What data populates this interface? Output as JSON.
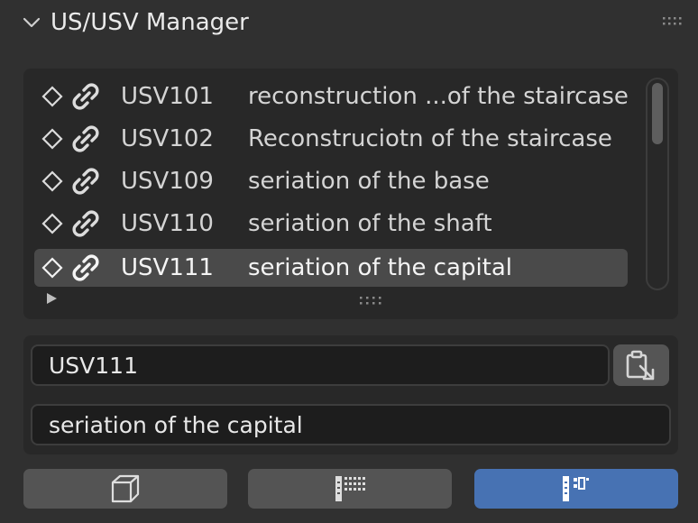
{
  "panel": {
    "title": "US/USV Manager",
    "collapse_icon": "chevron-down-icon",
    "grip_icon": "drag-grip-icon"
  },
  "list": {
    "selected_index": 4,
    "items": [
      {
        "code": "USV101",
        "description": "reconstruction ...of the staircase",
        "icon": "diamond-icon",
        "link_icon": "link-icon"
      },
      {
        "code": "USV102",
        "description": "Reconstruciotn of the staircase",
        "icon": "diamond-icon",
        "link_icon": "link-icon"
      },
      {
        "code": "USV109",
        "description": "seriation of the base",
        "icon": "diamond-icon",
        "link_icon": "link-icon"
      },
      {
        "code": "USV110",
        "description": "seriation of the shaft",
        "icon": "diamond-icon",
        "link_icon": "link-icon"
      },
      {
        "code": "USV111",
        "description": "seriation of the capital",
        "icon": "diamond-icon",
        "link_icon": "link-icon"
      }
    ]
  },
  "fields": {
    "name_value": "USV111",
    "description_value": "seriation of the capital",
    "paste_icon": "paste-icon"
  },
  "bottom_buttons": [
    {
      "icon": "cube-icon",
      "active": false
    },
    {
      "icon": "list-layout-icon",
      "active": false
    },
    {
      "icon": "grid-layout-icon",
      "active": true
    }
  ],
  "colors": {
    "background": "#303030",
    "list_background": "#282828",
    "selected_row": "#4a4a4a",
    "accent": "#4772b3",
    "button": "#545454"
  }
}
